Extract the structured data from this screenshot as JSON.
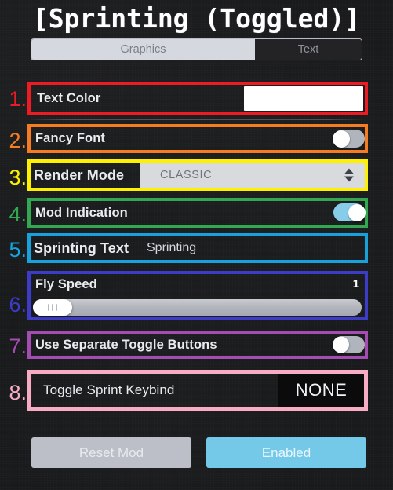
{
  "window": {
    "title": "[Sprinting (Toggled)]"
  },
  "tabs": {
    "graphics_label": "Graphics",
    "text_label": "Text",
    "selected": "Graphics"
  },
  "annotations": {
    "n1": "1.",
    "n2": "2.",
    "n3": "3.",
    "n4": "4.",
    "n5": "5.",
    "n6": "6.",
    "n7": "7.",
    "n8": "8.",
    "colors": {
      "c1": "#ed1c24",
      "c2": "#f57c20",
      "c3": "#fdf100",
      "c4": "#32a850",
      "c5": "#18a2dc",
      "c6": "#3c3cc8",
      "c7": "#a54bb4",
      "c8": "#f7acc4"
    }
  },
  "settings": {
    "text_color": {
      "label": "Text Color",
      "swatch_hex": "#ffffff"
    },
    "fancy_font": {
      "label": "Fancy Font",
      "value": "off"
    },
    "render_mode": {
      "label": "Render Mode",
      "value": "CLASSIC"
    },
    "mod_indication": {
      "label": "Mod Indication",
      "value": "on"
    },
    "sprinting_text": {
      "label": "Sprinting Text",
      "value": "Sprinting"
    },
    "fly_speed": {
      "label": "Fly Speed",
      "value": "1"
    },
    "separate_toggle_buttons": {
      "label": "Use Separate Toggle Buttons",
      "value": "off"
    },
    "toggle_sprint_keybind": {
      "label": "Toggle Sprint Keybind",
      "value": "NONE"
    }
  },
  "footer": {
    "reset_label": "Reset Mod",
    "enabled_label": "Enabled"
  }
}
